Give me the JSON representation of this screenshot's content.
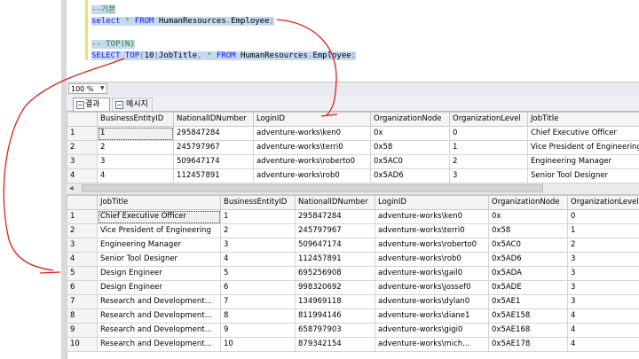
{
  "editor": {
    "lines": [
      {
        "kind": "comment",
        "text": "--기본"
      },
      {
        "kind": "code",
        "parts": [
          [
            "kw",
            "select"
          ],
          [
            "op",
            " * "
          ],
          [
            "kw",
            "FROM"
          ],
          [
            "tx",
            " HumanResources"
          ],
          [
            "op",
            "."
          ],
          [
            "tx",
            "Employee"
          ],
          [
            "op",
            ";"
          ]
        ]
      },
      {
        "kind": "blank",
        "text": ""
      },
      {
        "kind": "comment",
        "text": "-- TOP(N)"
      },
      {
        "kind": "code",
        "parts": [
          [
            "kw",
            "SELECT TOP"
          ],
          [
            "op",
            "("
          ],
          [
            "tx",
            "10"
          ],
          [
            "op",
            ")"
          ],
          [
            "tx",
            "JobTitle"
          ],
          [
            "op",
            ", * "
          ],
          [
            "kw",
            "FROM"
          ],
          [
            "tx",
            " HumanResources"
          ],
          [
            "op",
            "."
          ],
          [
            "tx",
            "Employee"
          ],
          [
            "op",
            ";"
          ]
        ]
      }
    ]
  },
  "zoom": {
    "value": "100 %"
  },
  "tabs": {
    "results": "결과",
    "messages": "메시지"
  },
  "grid1": {
    "columns": [
      "",
      "BusinessEntityID",
      "NationalIDNumber",
      "LoginID",
      "OrganizationNode",
      "OrganizationLevel",
      "JobTitle"
    ],
    "rows": [
      [
        "1",
        "1",
        "295847284",
        "adventure-works\\ken0",
        "0x",
        "0",
        "Chief Executive Officer"
      ],
      [
        "2",
        "2",
        "245797967",
        "adventure-works\\terri0",
        "0x58",
        "1",
        "Vice President of Engineering"
      ],
      [
        "3",
        "3",
        "509647174",
        "adventure-works\\roberto0",
        "0x5AC0",
        "2",
        "Engineering Manager"
      ],
      [
        "4",
        "4",
        "112457891",
        "adventure-works\\rob0",
        "0x5AD6",
        "3",
        "Senior Tool Designer"
      ]
    ]
  },
  "grid2": {
    "columns": [
      "",
      "JobTitle",
      "BusinessEntityID",
      "NationalIDNumber",
      "LoginID",
      "OrganizationNode",
      "OrganizationLevel"
    ],
    "rows": [
      [
        "1",
        "Chief Executive Officer",
        "1",
        "295847284",
        "adventure-works\\ken0",
        "0x",
        "0"
      ],
      [
        "2",
        "Vice President of Engineering",
        "2",
        "245797967",
        "adventure-works\\terri0",
        "0x58",
        "1"
      ],
      [
        "3",
        "Engineering Manager",
        "3",
        "509647174",
        "adventure-works\\roberto0",
        "0x5AC0",
        "2"
      ],
      [
        "4",
        "Senior Tool Designer",
        "4",
        "112457891",
        "adventure-works\\rob0",
        "0x5AD6",
        "3"
      ],
      [
        "5",
        "Design Engineer",
        "5",
        "695256908",
        "adventure-works\\gail0",
        "0x5ADA",
        "3"
      ],
      [
        "6",
        "Design Engineer",
        "6",
        "998320692",
        "adventure-works\\jossef0",
        "0x5ADE",
        "3"
      ],
      [
        "7",
        "Research and Development...",
        "7",
        "134969118",
        "adventure-works\\dylan0",
        "0x5AE1",
        "3"
      ],
      [
        "8",
        "Research and Development...",
        "8",
        "811994146",
        "adventure-works\\diane1",
        "0x5AE158",
        "4"
      ],
      [
        "9",
        "Research and Development...",
        "9",
        "658797903",
        "adventure-works\\gigi0",
        "0x5AE168",
        "4"
      ],
      [
        "10",
        "Research and Development...",
        "10",
        "879342154",
        "adventure-works\\mich...",
        "0x5AE178",
        "4"
      ]
    ]
  },
  "colors": {
    "annotation": "#e0201a",
    "keyword": "#1a1aff",
    "comment": "#1f8a1f",
    "selection": "#c5d9f1"
  }
}
